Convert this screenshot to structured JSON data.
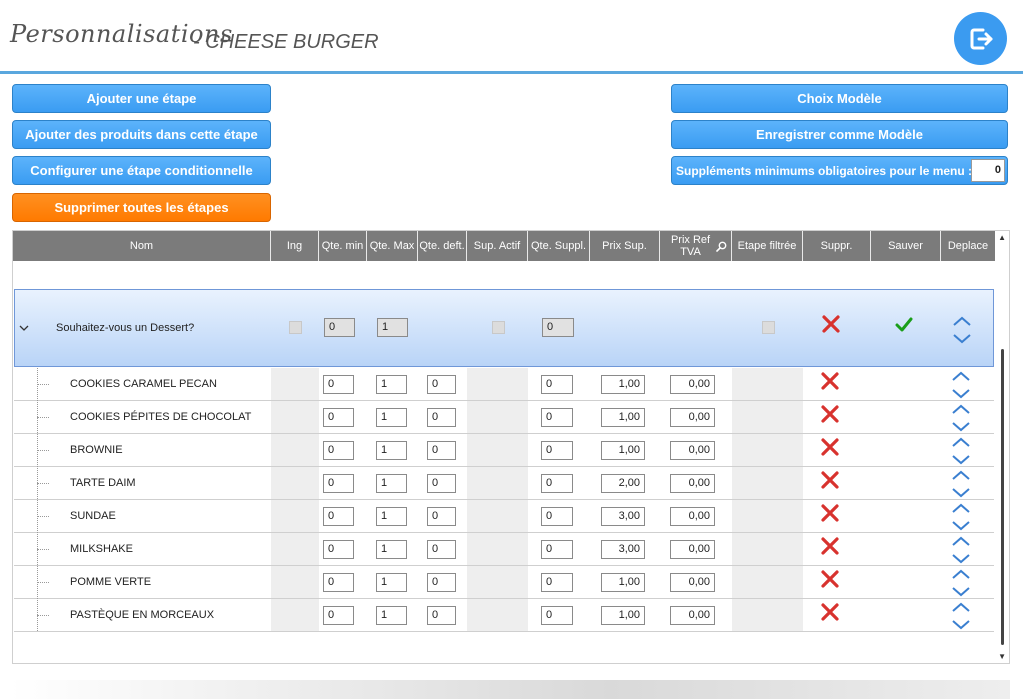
{
  "header": {
    "brand": "Personnalisations",
    "subtitle": "- CHEESE BURGER",
    "exit_icon": "logout-icon"
  },
  "actions": {
    "add_step": "Ajouter une étape",
    "add_products": "Ajouter des produits dans cette étape",
    "configure_conditional": "Configurer une étape conditionnelle",
    "delete_all": "Supprimer toutes les étapes",
    "choose_model": "Choix Modèle",
    "save_as_model": "Enregistrer comme Modèle",
    "min_supplements_label": "Suppléments minimums obligatoires pour le menu :",
    "min_supplements_value": "0"
  },
  "colors": {
    "accent": "#3a9cf2",
    "danger": "#ff7a00",
    "delete_x": "#d8322e",
    "save_check": "#1a9e1a",
    "mover": "#3a7fd0"
  },
  "table": {
    "columns": [
      "Nom",
      "Ing",
      "Qte. min",
      "Qte. Max",
      "Qte. deft.",
      "Sup. Actif",
      "Qte. Suppl.",
      "Prix Sup.",
      "Prix Ref TVA",
      "Etape filtrée",
      "Suppr.",
      "Sauver",
      "Deplace"
    ],
    "group": {
      "name": "Souhaitez-vous un Dessert?",
      "qte_min": "0",
      "qte_max": "1",
      "qte_suppl": "0"
    },
    "rows": [
      {
        "name": "COOKIES CARAMEL PECAN",
        "min": "0",
        "max": "1",
        "def": "0",
        "suppl": "0",
        "prix": "1,00",
        "ref": "0,00"
      },
      {
        "name": "COOKIES PÉPITES DE CHOCOLAT",
        "min": "0",
        "max": "1",
        "def": "0",
        "suppl": "0",
        "prix": "1,00",
        "ref": "0,00"
      },
      {
        "name": "BROWNIE",
        "min": "0",
        "max": "1",
        "def": "0",
        "suppl": "0",
        "prix": "1,00",
        "ref": "0,00"
      },
      {
        "name": "TARTE DAIM",
        "min": "0",
        "max": "1",
        "def": "0",
        "suppl": "0",
        "prix": "2,00",
        "ref": "0,00"
      },
      {
        "name": "SUNDAE",
        "min": "0",
        "max": "1",
        "def": "0",
        "suppl": "0",
        "prix": "3,00",
        "ref": "0,00"
      },
      {
        "name": "MILKSHAKE",
        "min": "0",
        "max": "1",
        "def": "0",
        "suppl": "0",
        "prix": "3,00",
        "ref": "0,00"
      },
      {
        "name": "POMME VERTE",
        "min": "0",
        "max": "1",
        "def": "0",
        "suppl": "0",
        "prix": "1,00",
        "ref": "0,00"
      },
      {
        "name": "PASTÈQUE EN MORCEAUX",
        "min": "0",
        "max": "1",
        "def": "0",
        "suppl": "0",
        "prix": "1,00",
        "ref": "0,00"
      }
    ]
  }
}
